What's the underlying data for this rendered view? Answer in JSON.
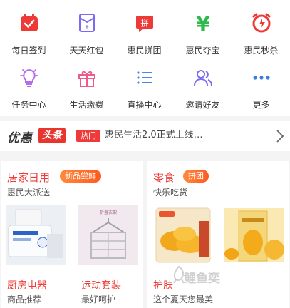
{
  "colors": {
    "accent": "#ec3a36",
    "primary_icon": "#7a6cf0",
    "green": "#2fb94a",
    "badge": "#ff6a2b"
  },
  "grid": {
    "items": [
      {
        "label": "每日签到",
        "icon": "calendar-check-icon"
      },
      {
        "label": "天天红包",
        "icon": "red-envelope-icon"
      },
      {
        "label": "惠民拼团",
        "icon": "group-buy-icon"
      },
      {
        "label": "惠民夺宝",
        "icon": "yuan-treasure-icon"
      },
      {
        "label": "惠民秒杀",
        "icon": "alarm-clock-icon"
      },
      {
        "label": "任务中心",
        "icon": "lightbulb-icon"
      },
      {
        "label": "生活缴费",
        "icon": "gift-icon"
      },
      {
        "label": "直播中心",
        "icon": "list-icon"
      },
      {
        "label": "邀请好友",
        "icon": "users-icon"
      },
      {
        "label": "更多",
        "icon": "more-dots-icon"
      }
    ]
  },
  "news": {
    "brand_part1": "优惠",
    "brand_part2": "头条",
    "tag": "热门",
    "headline": "惠民生活2.0正式上线…"
  },
  "cards": {
    "left": {
      "title": "居家日用",
      "badge": "新品尝鲜",
      "subtitle": "惠民大派送",
      "bottom": [
        {
          "title": "厨房电器",
          "subtitle": "商品推荐"
        },
        {
          "title": "运动套装",
          "subtitle": "最好呵护"
        }
      ]
    },
    "right": {
      "title": "零食",
      "badge": "拼团",
      "subtitle": "快乐吃货",
      "bottom": [
        {
          "title": "护肤",
          "subtitle": "这个夏天您最美"
        }
      ]
    }
  },
  "watermark": "鲤鱼奕"
}
